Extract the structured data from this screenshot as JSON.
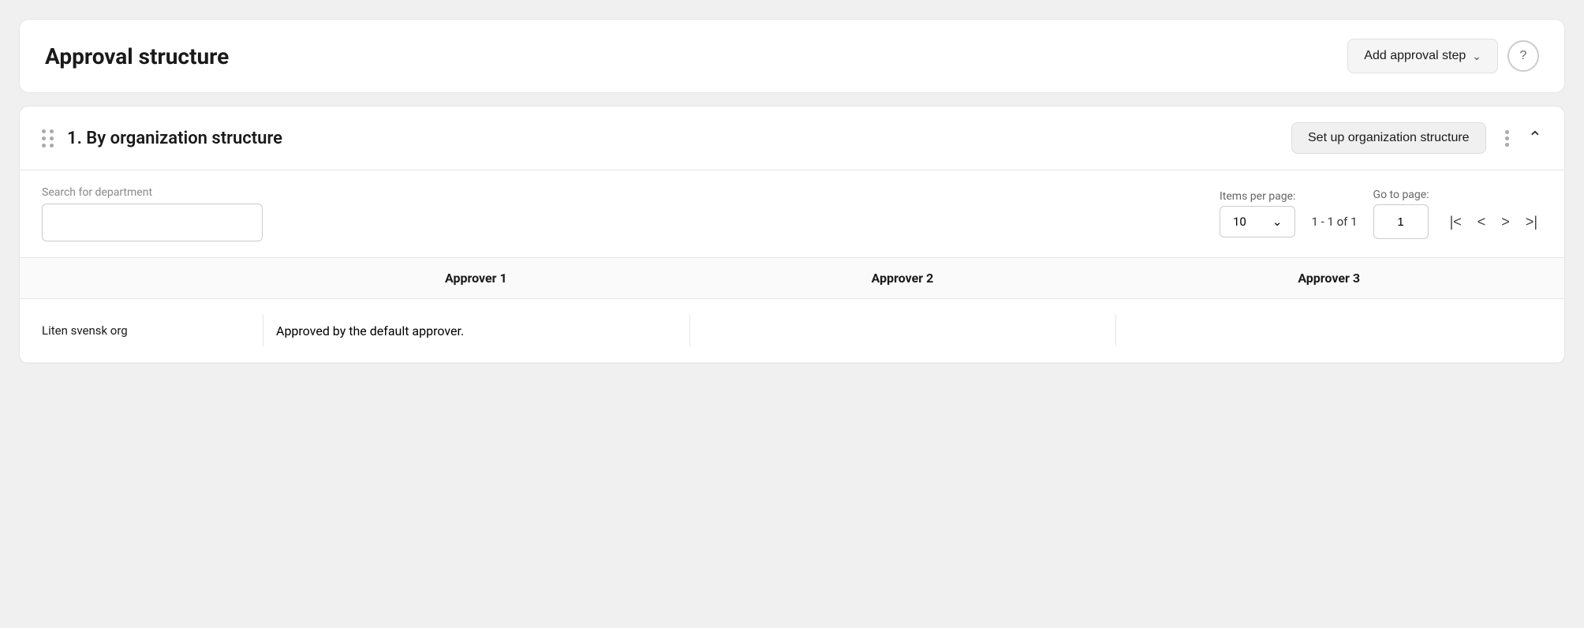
{
  "page": {
    "background": "#f0f0f0"
  },
  "top_card": {
    "title": "Approval structure",
    "add_btn_label": "Add approval step",
    "help_icon": "?"
  },
  "section": {
    "title": "1. By organization structure",
    "setup_btn_label": "Set up organization structure",
    "drag_icon": "drag-handle",
    "more_icon": "more-vertical",
    "collapse_icon": "chevron-up"
  },
  "controls": {
    "search_label": "Search for department",
    "search_placeholder": "",
    "items_label": "Items per page:",
    "items_value": "10",
    "page_info": "1 - 1 of 1",
    "go_label": "Go to page:",
    "go_value": "1",
    "nav": {
      "first": "|<",
      "prev": "<",
      "next": ">",
      "last": ">|"
    }
  },
  "table": {
    "columns": [
      "",
      "Approver 1",
      "Approver 2",
      "Approver 3"
    ],
    "rows": [
      {
        "department": "Liten svensk org",
        "approver1": "Approved by the default approver.",
        "approver2": "",
        "approver3": ""
      }
    ]
  }
}
